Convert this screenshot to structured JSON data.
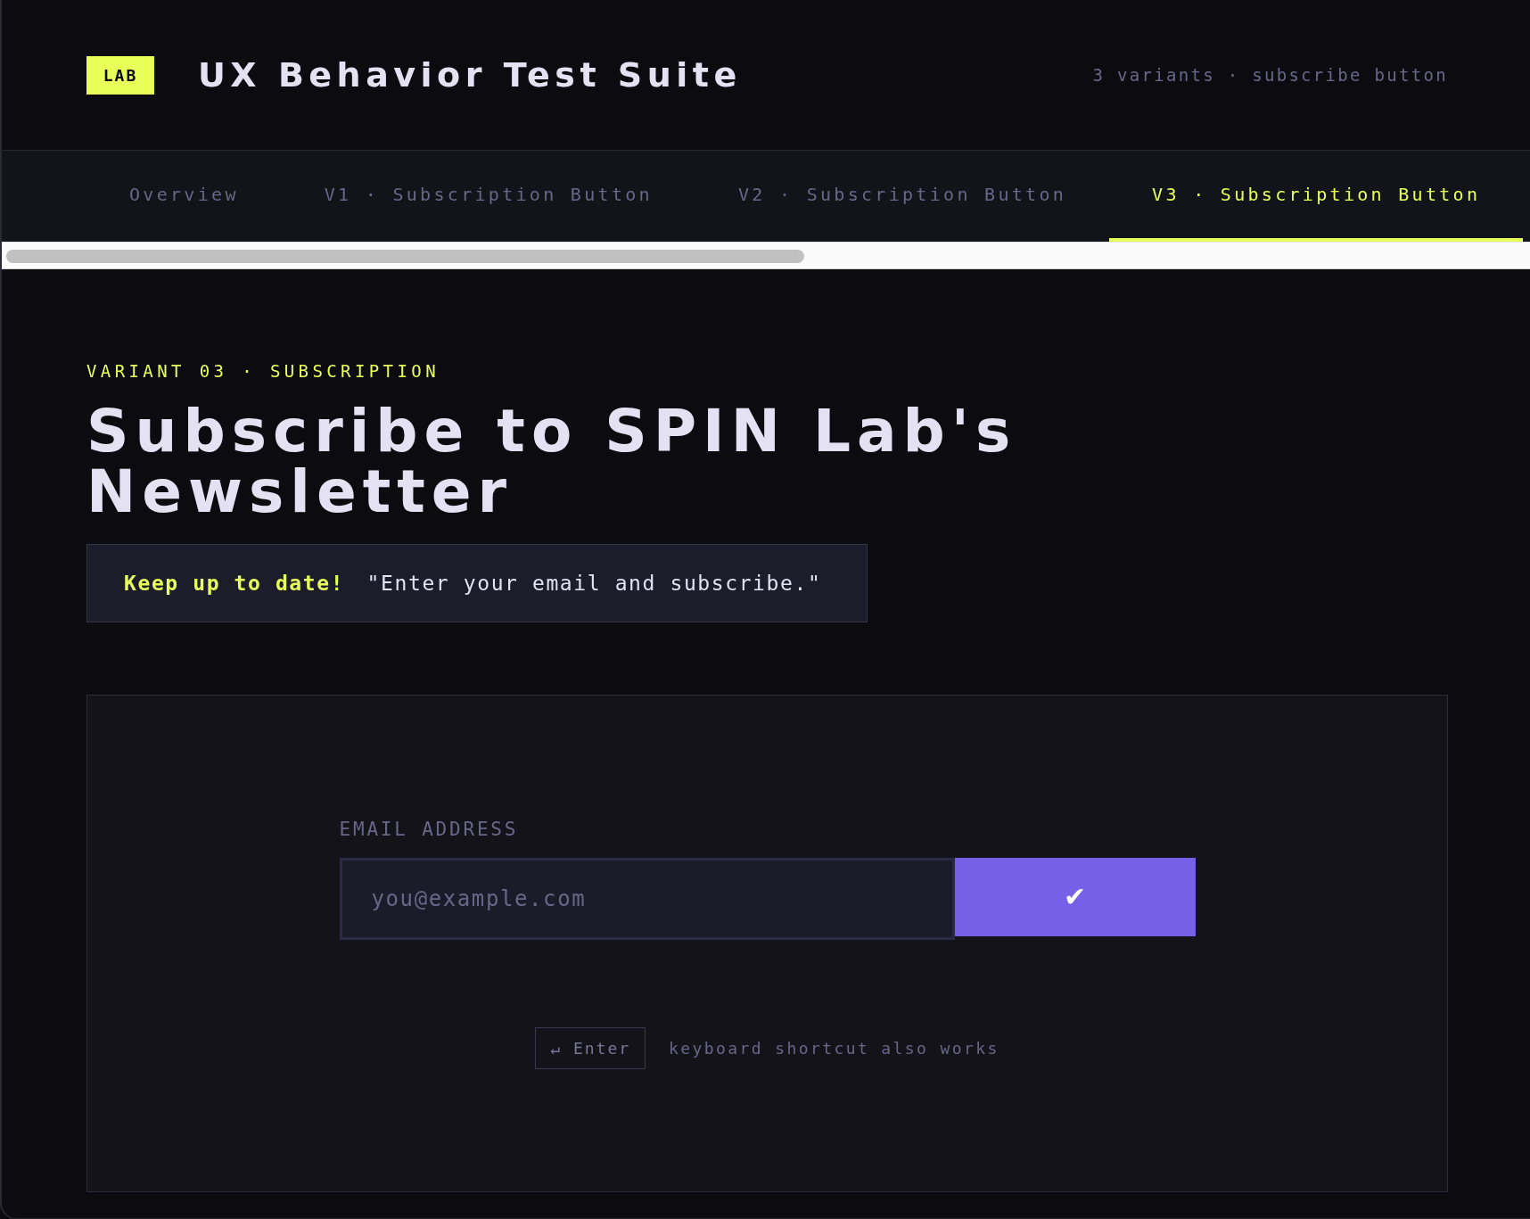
{
  "header": {
    "badge": "LAB",
    "title": "UX Behavior Test Suite",
    "meta": "3 variants · subscribe button"
  },
  "tabs": [
    {
      "label": "Overview",
      "selected": false
    },
    {
      "label": "V1 · Subscription Button",
      "selected": false
    },
    {
      "label": "V2 · Subscription Button",
      "selected": false
    },
    {
      "label": "V3 · Subscription Button",
      "selected": true
    }
  ],
  "variant": {
    "eyebrow": "VARIANT 03 · SUBSCRIPTION",
    "heading": "Subscribe to SPIN Lab's Newsletter",
    "callout": "**Keep up to date!** \"Enter your email and subscribe.\""
  },
  "form": {
    "label": "EMAIL ADDRESS",
    "email": {
      "placeholder": "you@example.com"
    },
    "submit": {
      "label": "✔"
    },
    "shortcut": {
      "key": "↵ Enter",
      "hint": "keyboard shortcut also works"
    }
  }
}
